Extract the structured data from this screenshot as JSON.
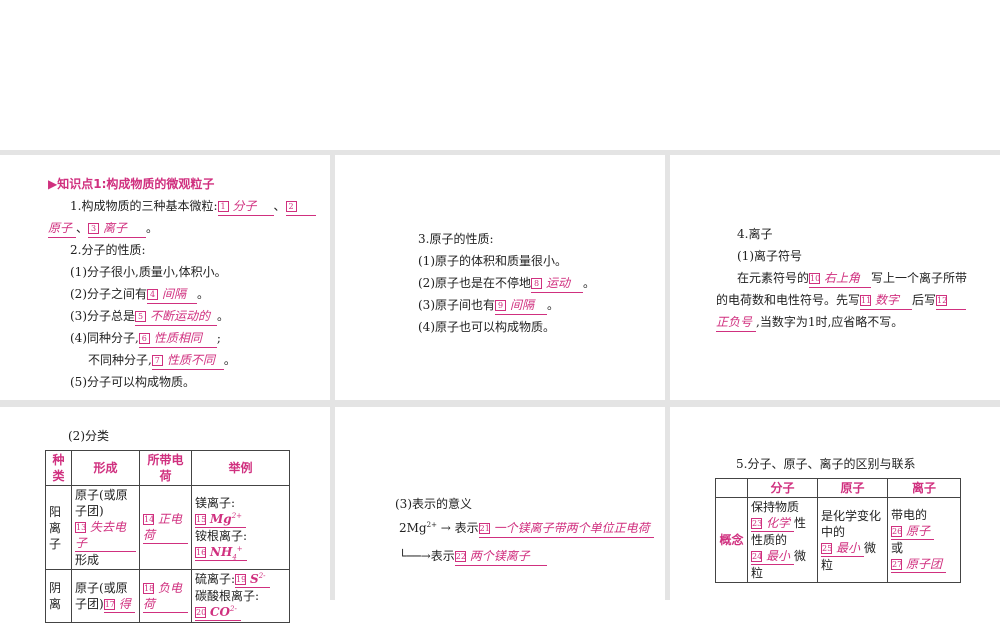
{
  "p1": {
    "title": "知识点1:构成物质的微观粒子",
    "l1": "1.构成物质的三种基本微粒:",
    "a1": "分子",
    "a2": "原子",
    "a3": "离子",
    "l2": "2.分子的性质:",
    "l3": "(1)分子很小,质量小,体积小。",
    "l4": "(2)分子之间有",
    "a4": "间隔",
    "l5": "(3)分子总是",
    "a5": "不断运动的",
    "l6": "(4)同种分子,",
    "a6": "性质相同",
    "l7": "不同种分子,",
    "a7": "性质不同",
    "l8": "(5)分子可以构成物质。"
  },
  "p2": {
    "l1": "3.原子的性质:",
    "l2": "(1)原子的体积和质量很小。",
    "l3": "(2)原子也是在不停地",
    "a8": "运动",
    "l4": "(3)原子间也有",
    "a9": "间隔",
    "l5": "(4)原子也可以构成物质。"
  },
  "p3": {
    "l1": "4.离子",
    "l2": "(1)离子符号",
    "l3": "在元素符号的",
    "a10": "右上角",
    "l3b": "写上一个离子所带",
    "l4": "的电荷数和电性符号。先写",
    "a11": "数字",
    "l4b": "后写",
    "a12": "正负号",
    "l5": ",当数字为1时,应省略不写。"
  },
  "p4": {
    "l1": "(2)分类",
    "headers": [
      "种类",
      "形成",
      "所带电荷",
      "举例"
    ],
    "r1": {
      "kind": "阳离子",
      "form": "原子(或原子团)",
      "a13": "失去电子",
      "form_end": "形成",
      "a14": "正电荷",
      "ex1": "镁离子:",
      "a15": "Mg",
      "a15sup": "2+",
      "ex2": "铵根离子:",
      "a16": "NH",
      "a16sub": "4",
      "a16sup": "+"
    },
    "r2": {
      "kind": "阴离",
      "form": "原子(或原子团)",
      "a17": "得",
      "a18": "负电荷",
      "ex1": "硫离子:",
      "a19": "S",
      "a19sup": "2-",
      "ex2": "碳酸根离子:",
      "a20": "CO",
      "a20sup": "2-"
    }
  },
  "p5": {
    "l1": "(3)表示的意义",
    "sym": "2Mg",
    "symsup": "2+",
    "arrow": "→ 表示",
    "a21": "一个镁离子带两个单位正电荷",
    "arrow2": "──→表示",
    "a22": "两个镁离子"
  },
  "p6": {
    "l1": "5.分子、原子、离子的区别与联系",
    "headers": [
      "",
      "分子",
      "原子",
      "离子"
    ],
    "row": "概念",
    "c1a": "保持物质",
    "a23": "化学",
    "c1b": "性质的",
    "a24": "最小",
    "c1c": "微粒",
    "c2a": "是化学变化中的",
    "a25": "最小",
    "c2b": "微粒",
    "c3a": "带电的",
    "a26": "原子",
    "c3b": "或",
    "a27": "原子团"
  },
  "nums": [
    "1",
    "2",
    "3",
    "4",
    "5",
    "6",
    "7",
    "8",
    "9",
    "10",
    "11",
    "12",
    "13",
    "14",
    "15",
    "16",
    "17",
    "18",
    "19",
    "20",
    "21",
    "22",
    "23",
    "24",
    "25",
    "26",
    "27"
  ]
}
